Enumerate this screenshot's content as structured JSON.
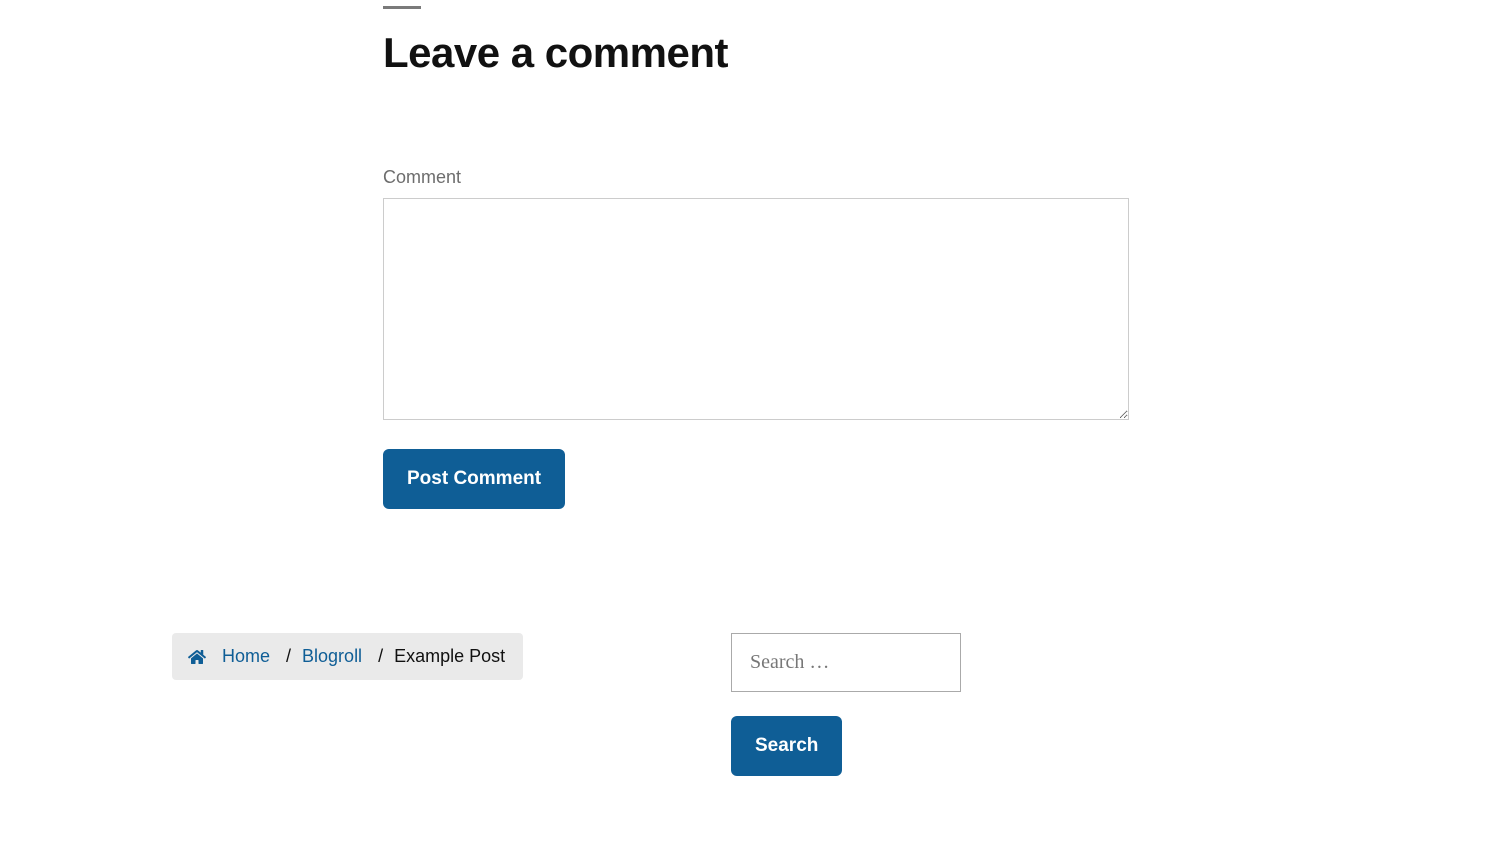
{
  "comment_form": {
    "heading": "Leave a comment",
    "label": "Comment",
    "submit_label": "Post Comment"
  },
  "breadcrumb": {
    "items": [
      {
        "label": "Home"
      },
      {
        "label": "Blogroll"
      },
      {
        "label": "Example Post"
      }
    ]
  },
  "search": {
    "placeholder": "Search …",
    "button_label": "Search"
  }
}
